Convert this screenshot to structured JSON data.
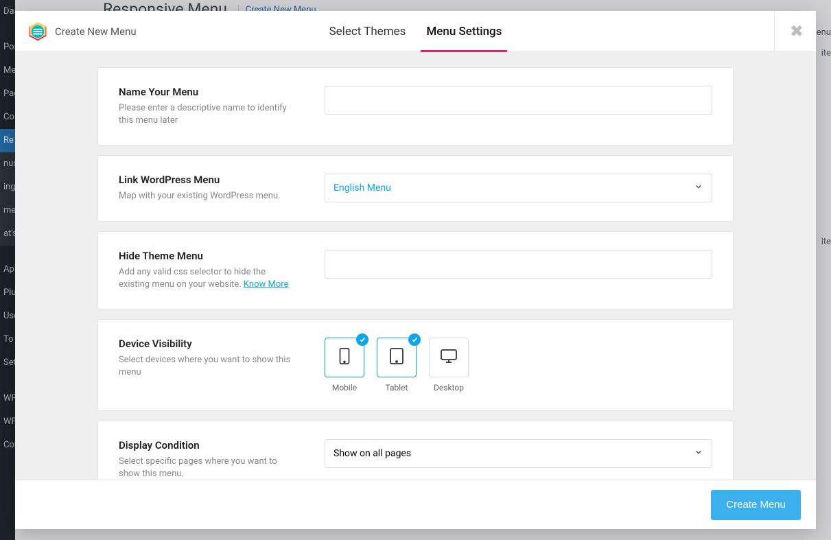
{
  "bg": {
    "title": "Responsive Menu",
    "title_link": "Create New Menu",
    "side1": "enu",
    "side2": "ite",
    "side3": "ite"
  },
  "sidebar_items": [
    {
      "label": "Dashboard",
      "active": false
    },
    {
      "label": "",
      "sep": true
    },
    {
      "label": "Posts",
      "active": false
    },
    {
      "label": "Media",
      "active": false
    },
    {
      "label": "Pages",
      "active": false
    },
    {
      "label": "Comments",
      "active": false
    },
    {
      "label": "Responsive Menu",
      "active": true
    },
    {
      "label": "",
      "sep": false,
      "sub": true,
      "sublabel": "nus"
    },
    {
      "label": "",
      "sep": false,
      "sub": true,
      "sublabel": "ings"
    },
    {
      "label": "",
      "sep": false,
      "sub": true,
      "sublabel": "mes"
    },
    {
      "label": "",
      "sep": false,
      "sub": true,
      "sublabel": "at's"
    },
    {
      "label": "",
      "sep": true
    },
    {
      "label": "Appearance",
      "active": false
    },
    {
      "label": "Plugins",
      "active": false
    },
    {
      "label": "Users",
      "active": false
    },
    {
      "label": "Tools",
      "active": false
    },
    {
      "label": "Settings",
      "active": false
    },
    {
      "label": "",
      "sep": true
    },
    {
      "label": "WPForms",
      "active": false
    },
    {
      "label": "WPML",
      "active": false
    },
    {
      "label": "Collapse",
      "active": false
    }
  ],
  "modal": {
    "brand_title": "Create New Menu",
    "tabs": {
      "select_themes": "Select Themes",
      "menu_settings": "Menu Settings"
    },
    "footer_button": "Create Menu"
  },
  "sections": {
    "name": {
      "title": "Name Your Menu",
      "desc": "Please enter a descriptive name to identify this menu later",
      "value": ""
    },
    "link": {
      "title": "Link WordPress Menu",
      "desc": "Map with your existing WordPress menu.",
      "selected": "English Menu"
    },
    "hide": {
      "title": "Hide Theme Menu",
      "desc": "Add any valid css selector to hide the existing menu on your website. ",
      "link": "Know More",
      "value": ""
    },
    "device": {
      "title": "Device Visibility",
      "desc": "Select devices where you want to show this menu",
      "mobile": "Mobile",
      "tablet": "Tablet",
      "desktop": "Desktop"
    },
    "display": {
      "title": "Display Condition",
      "desc": "Select specific pages where you want to show this menu.",
      "selected": "Show on all pages"
    }
  }
}
